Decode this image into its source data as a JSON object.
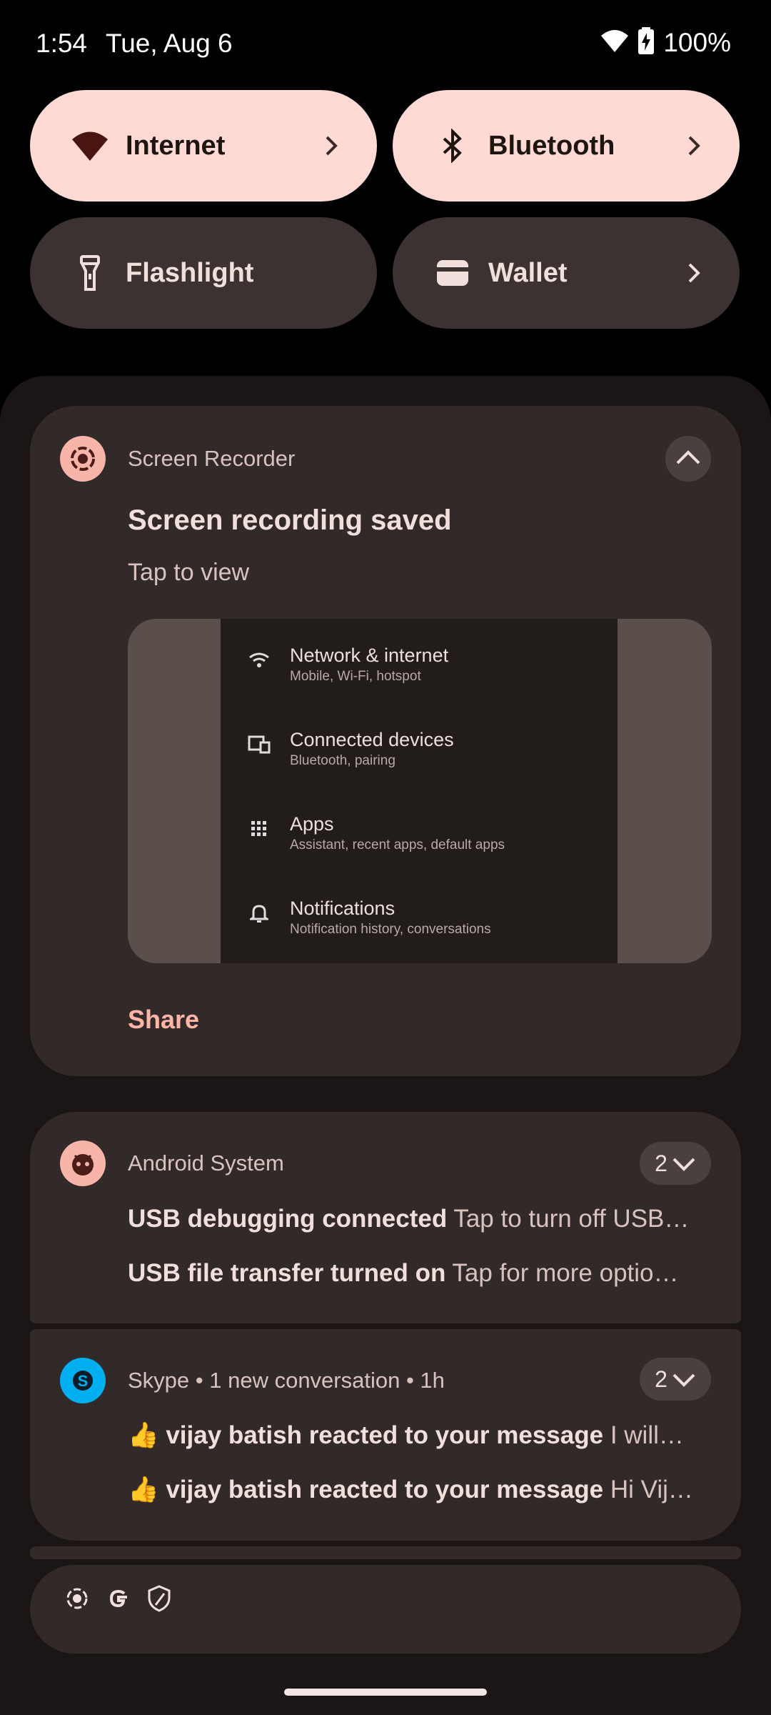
{
  "status_bar": {
    "time": "1:54",
    "date": "Tue, Aug 6",
    "battery": "100%"
  },
  "quick_settings": [
    {
      "label": "Internet",
      "icon": "wifi-icon",
      "state": "on"
    },
    {
      "label": "Bluetooth",
      "icon": "bluetooth-icon",
      "state": "on"
    },
    {
      "label": "Flashlight",
      "icon": "flashlight-icon",
      "state": "off"
    },
    {
      "label": "Wallet",
      "icon": "wallet-icon",
      "state": "off"
    }
  ],
  "screen_recorder": {
    "app_name": "Screen Recorder",
    "title": "Screen recording saved",
    "subtitle": "Tap to view",
    "action": "Share",
    "preview_items": [
      {
        "title": "Network & internet",
        "subtitle": "Mobile, Wi-Fi, hotspot",
        "icon": "wifi-icon"
      },
      {
        "title": "Connected devices",
        "subtitle": "Bluetooth, pairing",
        "icon": "devices-icon"
      },
      {
        "title": "Apps",
        "subtitle": "Assistant, recent apps, default apps",
        "icon": "apps-grid-icon"
      },
      {
        "title": "Notifications",
        "subtitle": "Notification history, conversations",
        "icon": "bell-icon"
      }
    ]
  },
  "android_system": {
    "app_name": "Android System",
    "count": "2",
    "lines": [
      {
        "title": "USB debugging connected",
        "text": "Tap to turn off USB…"
      },
      {
        "title": "USB file transfer turned on",
        "text": "Tap for more optio…"
      }
    ]
  },
  "skype": {
    "header": "Skype • 1 new conversation • 1h",
    "count": "2",
    "lines": [
      {
        "emoji": "👍",
        "title": "vijay batish reacted to your message",
        "text": "I will…"
      },
      {
        "emoji": "👍",
        "title": "vijay batish reacted to your message",
        "text": "Hi Vij…"
      }
    ]
  },
  "colors": {
    "tile_on": "#ffd9d4",
    "tile_off": "#3b3231",
    "card_bg": "#322a29",
    "accent": "#ffb4a8",
    "skype_blue": "#00aff0"
  }
}
